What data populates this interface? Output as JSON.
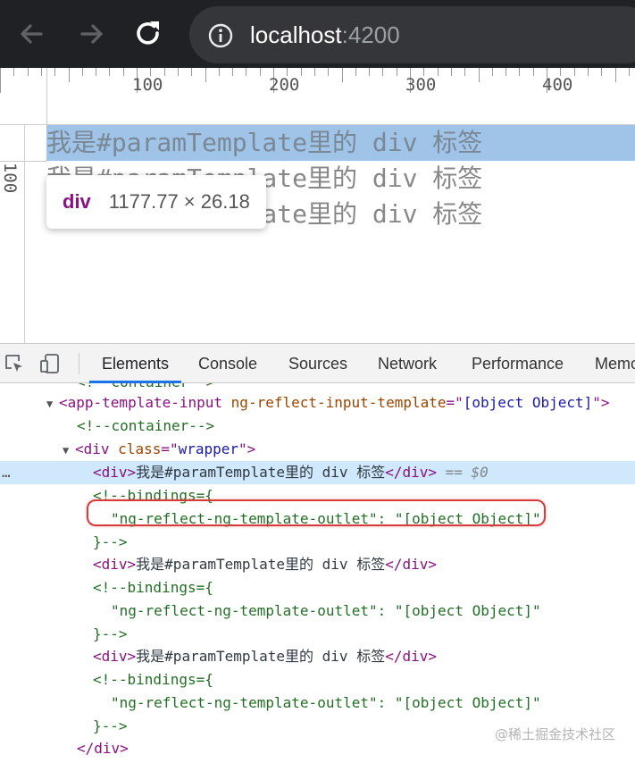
{
  "browser": {
    "url_host": "localhost",
    "url_port": ":4200",
    "colors": {
      "toolbar_bg": "#202124",
      "omnibox_bg": "#35363a"
    }
  },
  "viewport": {
    "ruler": {
      "horizontal_ticks": [
        "100",
        "200",
        "300",
        "400"
      ],
      "vertical_ticks": [
        "100"
      ]
    },
    "page_lines": [
      "我是#paramTemplate里的 div 标签",
      "我是#paramTemplate里的 div 标签",
      "我是#paramTemplate里的 div 标签"
    ],
    "tooltip": {
      "tag": "div",
      "size": "1177.77 × 26.18"
    },
    "colors": {
      "highlight": "#9fc4e8"
    }
  },
  "devtools": {
    "tabs": [
      "Elements",
      "Console",
      "Sources",
      "Network",
      "Performance",
      "Memo"
    ],
    "active_tab": "Elements",
    "tree": {
      "partial_comment": "<!--container-->",
      "app_tag_open": "<app-template-input",
      "app_attr_name": "ng-reflect-input-template",
      "app_attr_eq": "=\"",
      "app_attr_value": "[object Object]",
      "app_attr_close": "\">",
      "container_comment": "<!--container-->",
      "wrapper_tag_open": "<div",
      "wrapper_attr_name": "class",
      "wrapper_attr_eq": "=\"",
      "wrapper_attr_value": "wrapper",
      "wrapper_attr_close": "\">",
      "div_open": "<div>",
      "div_text": "我是#paramTemplate里的 div 标签",
      "div_close": "</div>",
      "selected_suffix": " == $0",
      "bindings_open": "<!--bindings={",
      "bindings_body": "\"ng-reflect-ng-template-outlet\": \"[object Object]\"",
      "bindings_close": "}-->",
      "wrapper_close": "</div>",
      "gutter_dots": "…"
    }
  },
  "watermark": "@稀土掘金技术社区"
}
